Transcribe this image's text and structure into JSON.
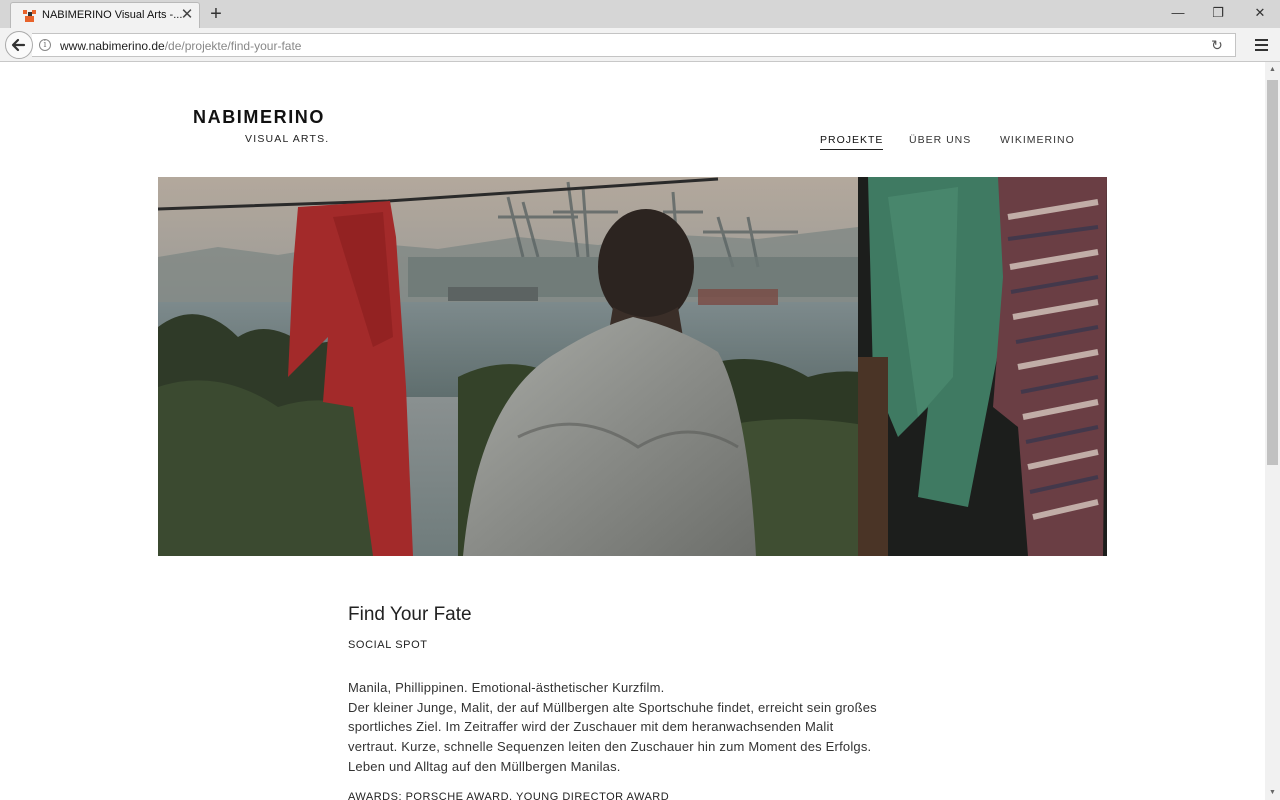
{
  "browser": {
    "tab_title": "NABIMERINO Visual Arts -...",
    "url_host": "www.nabimerino.de",
    "url_path": "/de/projekte/find-your-fate",
    "tab_close_glyph": "✕",
    "new_tab_glyph": "+",
    "minimize_glyph": "—",
    "restore_glyph": "❐",
    "window_close_glyph": "✕",
    "reload_glyph": "↻"
  },
  "site": {
    "logo_main": "NABIMERINO",
    "logo_sub": "VISUAL ARTS.",
    "nav": [
      {
        "label": "PROJEKTE",
        "active": true
      },
      {
        "label": "ÜBER UNS",
        "active": false
      },
      {
        "label": "WIKIMERINO",
        "active": false
      }
    ]
  },
  "project": {
    "title": "Find Your Fate",
    "category": "SOCIAL SPOT",
    "description_lines": [
      "Manila, Phillippinen. Emotional-ästhetischer Kurzfilm.",
      "Der kleiner Junge, Malit, der auf Müllbergen alte Sportschuhe findet, erreicht sein großes",
      "sportliches Ziel. Im Zeitraffer wird der Zuschauer mit dem heranwachsenden Malit",
      "vertraut. Kurze, schnelle Sequenzen leiten den Zuschauer hin zum Moment des Erfolgs.",
      "Leben und Alltag auf den Müllbergen Manilas."
    ],
    "awards": "AWARDS: PORSCHE AWARD, YOUNG DIRECTOR AWARD"
  },
  "colors": {
    "accent_orange": "#e8632b",
    "text": "#222222",
    "chrome_bg": "#f2f2f2"
  },
  "icons": {
    "back": "back-arrow-icon",
    "info": "info-icon",
    "menu": "hamburger-menu-icon",
    "favicon": "nabimerino-favicon-icon"
  }
}
